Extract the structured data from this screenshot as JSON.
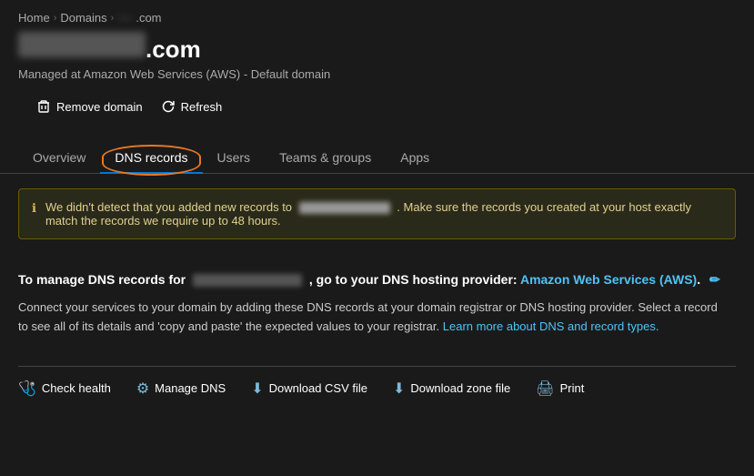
{
  "breadcrumb": {
    "home": "Home",
    "domains": "Domains",
    "current_blurred": "example",
    "current_suffix": ".com"
  },
  "page": {
    "title_blurred": true,
    "title_suffix": ".com",
    "subtitle": "Managed at Amazon Web Services (AWS) - Default domain"
  },
  "actions": {
    "remove_domain": "Remove domain",
    "refresh": "Refresh"
  },
  "tabs": [
    {
      "id": "overview",
      "label": "Overview",
      "active": false
    },
    {
      "id": "dns-records",
      "label": "DNS records",
      "active": true
    },
    {
      "id": "users",
      "label": "Users",
      "active": false
    },
    {
      "id": "teams-groups",
      "label": "Teams & groups",
      "active": false
    },
    {
      "id": "apps",
      "label": "Apps",
      "active": false
    }
  ],
  "alert": {
    "text_before": "We didn't detect that you added new records to",
    "text_blurred": "example.com",
    "text_after": ". Make sure the records you created at your host exactly match the records we require up to 48 hours."
  },
  "dns_manage": {
    "label_before": "To manage DNS records for",
    "domain_blurred": "example.com",
    "label_after": ", go to your DNS hosting provider:",
    "provider_link": "Amazon Web Services (AWS)",
    "provider_link_suffix": "."
  },
  "dns_description": {
    "text": "Connect your services to your domain by adding these DNS records at your domain registrar or DNS hosting provider. Select a record to see all of its details and 'copy and paste' the expected values to your registrar.",
    "learn_link_text": "Learn more about DNS and record types."
  },
  "bottom_actions": [
    {
      "id": "check-health",
      "label": "Check health",
      "icon": "heart"
    },
    {
      "id": "manage-dns",
      "label": "Manage DNS",
      "icon": "gear"
    },
    {
      "id": "download-csv",
      "label": "Download CSV file",
      "icon": "download"
    },
    {
      "id": "download-zone",
      "label": "Download zone file",
      "icon": "download"
    },
    {
      "id": "print",
      "label": "Print",
      "icon": "print"
    }
  ]
}
